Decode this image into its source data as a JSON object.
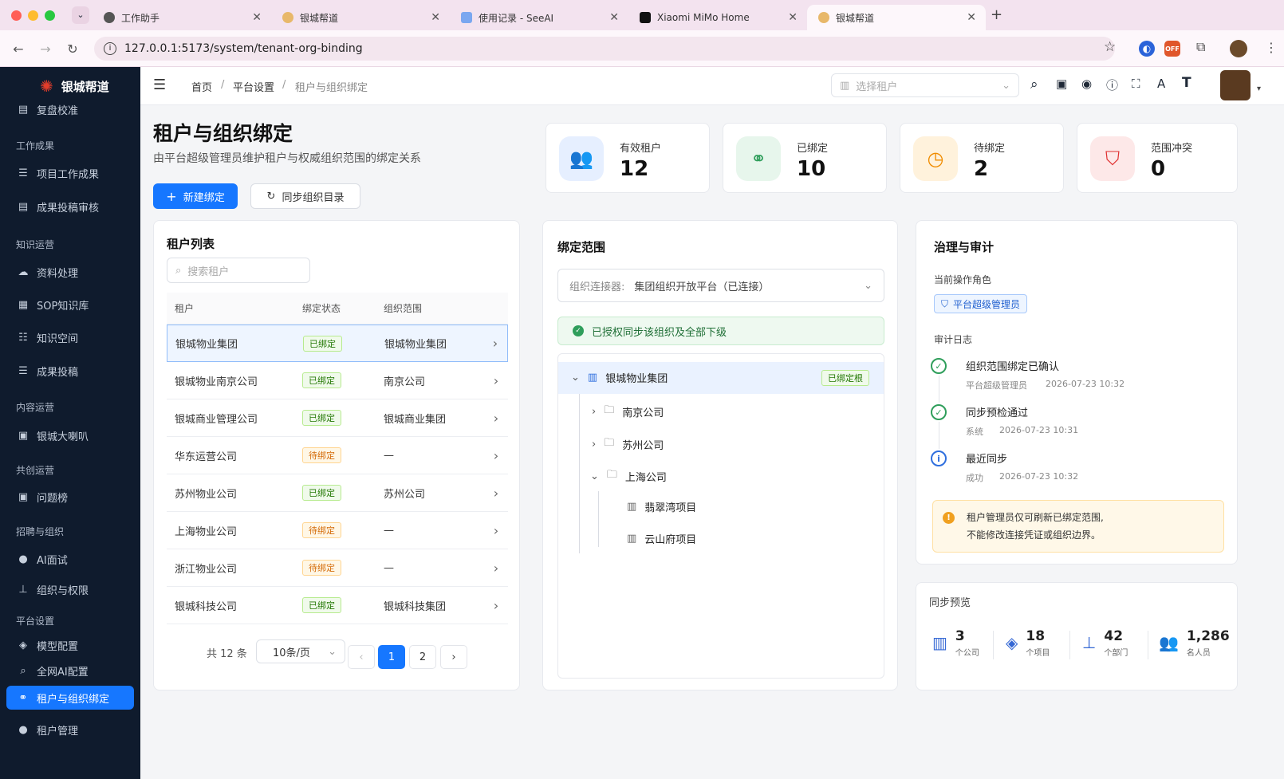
{
  "browser": {
    "tabs": [
      {
        "title": "工作助手",
        "active": false
      },
      {
        "title": "银城帮道",
        "active": false
      },
      {
        "title": "使用记录 - SeeAI",
        "active": false
      },
      {
        "title": "Xiaomi MiMo Home",
        "active": false
      },
      {
        "title": "银城帮道",
        "active": true
      }
    ],
    "url": "127.0.0.1:5173/system/tenant-org-binding",
    "ext_badge": "OFF"
  },
  "sidebar": {
    "brand": "银城帮道",
    "items": [
      {
        "type": "item",
        "label": "复盘校准",
        "icon": "▤"
      },
      {
        "type": "group",
        "label": "工作成果"
      },
      {
        "type": "item",
        "label": "项目工作成果",
        "icon": "☰"
      },
      {
        "type": "item",
        "label": "成果投稿审核",
        "icon": "▤"
      },
      {
        "type": "group",
        "label": "知识运营"
      },
      {
        "type": "item",
        "label": "资料处理",
        "icon": "☁"
      },
      {
        "type": "item",
        "label": "SOP知识库",
        "icon": "▦"
      },
      {
        "type": "item",
        "label": "知识空间",
        "icon": "☷"
      },
      {
        "type": "item",
        "label": "成果投稿",
        "icon": "☰"
      },
      {
        "type": "group",
        "label": "内容运营"
      },
      {
        "type": "item",
        "label": "银城大喇叭",
        "icon": "▣"
      },
      {
        "type": "group",
        "label": "共创运营"
      },
      {
        "type": "item",
        "label": "问题榜",
        "icon": "▣"
      },
      {
        "type": "group",
        "label": "招聘与组织"
      },
      {
        "type": "item",
        "label": "AI面试",
        "icon": "●"
      },
      {
        "type": "item",
        "label": "组织与权限",
        "icon": "⊥"
      },
      {
        "type": "group",
        "label": "平台设置"
      },
      {
        "type": "item",
        "label": "模型配置",
        "icon": "◈"
      },
      {
        "type": "item",
        "label": "全网AI配置",
        "icon": "⌕"
      },
      {
        "type": "item",
        "label": "租户与组织绑定",
        "icon": "⚭",
        "active": true
      },
      {
        "type": "item",
        "label": "租户管理",
        "icon": "●"
      }
    ]
  },
  "topbar": {
    "breadcrumb": [
      "首页",
      "平台设置",
      "租户与组织绑定"
    ],
    "tenant_select_placeholder": "选择租户"
  },
  "page": {
    "title": "租户与组织绑定",
    "subtitle": "由平台超级管理员维护租户与权威组织范围的绑定关系",
    "new_button": "新建绑定",
    "sync_button": "同步组织目录"
  },
  "stats": [
    {
      "label": "有效租户",
      "value": "12",
      "icon": "users-icon",
      "color": "#2f6fde",
      "bg": "#e6efff"
    },
    {
      "label": "已绑定",
      "value": "10",
      "icon": "link-icon",
      "color": "#2f9e5b",
      "bg": "#e7f6ec"
    },
    {
      "label": "待绑定",
      "value": "2",
      "icon": "clock-icon",
      "color": "#f08c00",
      "bg": "#fff2dc"
    },
    {
      "label": "范围冲突",
      "value": "0",
      "icon": "shield-alert-icon",
      "color": "#e03131",
      "bg": "#fde8e8"
    }
  ],
  "tenant_list": {
    "title": "租户列表",
    "search_placeholder": "搜索租户",
    "columns": [
      "租户",
      "绑定状态",
      "组织范围"
    ],
    "rows": [
      {
        "name": "银城物业集团",
        "status": "已绑定",
        "scope": "银城物业集团",
        "bound": true,
        "selected": true
      },
      {
        "name": "银城物业南京公司",
        "status": "已绑定",
        "scope": "南京公司",
        "bound": true
      },
      {
        "name": "银城商业管理公司",
        "status": "已绑定",
        "scope": "银城商业集团",
        "bound": true
      },
      {
        "name": "华东运营公司",
        "status": "待绑定",
        "scope": "—",
        "bound": false
      },
      {
        "name": "苏州物业公司",
        "status": "已绑定",
        "scope": "苏州公司",
        "bound": true
      },
      {
        "name": "上海物业公司",
        "status": "待绑定",
        "scope": "—",
        "bound": false
      },
      {
        "name": "浙江物业公司",
        "status": "待绑定",
        "scope": "—",
        "bound": false
      },
      {
        "name": "银城科技公司",
        "status": "已绑定",
        "scope": "银城科技集团",
        "bound": true
      }
    ],
    "total": "共 12 条",
    "page_size": "10条/页",
    "pages": [
      "1",
      "2"
    ],
    "current_page": "1"
  },
  "binding_scope": {
    "title": "绑定范围",
    "connector_label": "组织连接器:",
    "connector_value": "集团组织开放平台（已连接）",
    "notice": "已授权同步该组织及全部下级",
    "root": {
      "name": "银城物业集团",
      "badge": "已绑定根"
    },
    "children": [
      {
        "name": "南京公司",
        "expanded": false
      },
      {
        "name": "苏州公司",
        "expanded": false
      },
      {
        "name": "上海公司",
        "expanded": true
      }
    ],
    "grandchildren": [
      {
        "name": "翡翠湾项目"
      },
      {
        "name": "云山府项目"
      }
    ]
  },
  "governance": {
    "title": "治理与审计",
    "role_label": "当前操作角色",
    "role": "平台超级管理员",
    "log_label": "审计日志",
    "logs": [
      {
        "title": "组织范围绑定已确认",
        "actor": "平台超级管理员",
        "time": "2026-07-23 10:32",
        "kind": "success"
      },
      {
        "title": "同步预检通过",
        "actor": "系统",
        "time": "2026-07-23 10:31",
        "kind": "success"
      },
      {
        "title": "最近同步",
        "actor": "成功",
        "time": "2026-07-23 10:32",
        "kind": "info"
      }
    ],
    "warning": [
      "租户管理员仅可刷新已绑定范围,",
      "不能修改连接凭证或组织边界。"
    ]
  },
  "sync_preview": {
    "title": "同步预览",
    "items": [
      {
        "value": "3",
        "unit": "个公司",
        "icon": "building-icon"
      },
      {
        "value": "18",
        "unit": "个项目",
        "icon": "layers-icon"
      },
      {
        "value": "42",
        "unit": "个部门",
        "icon": "org-chart-icon"
      },
      {
        "value": "1,286",
        "unit": "名人员",
        "icon": "people-icon"
      }
    ]
  }
}
